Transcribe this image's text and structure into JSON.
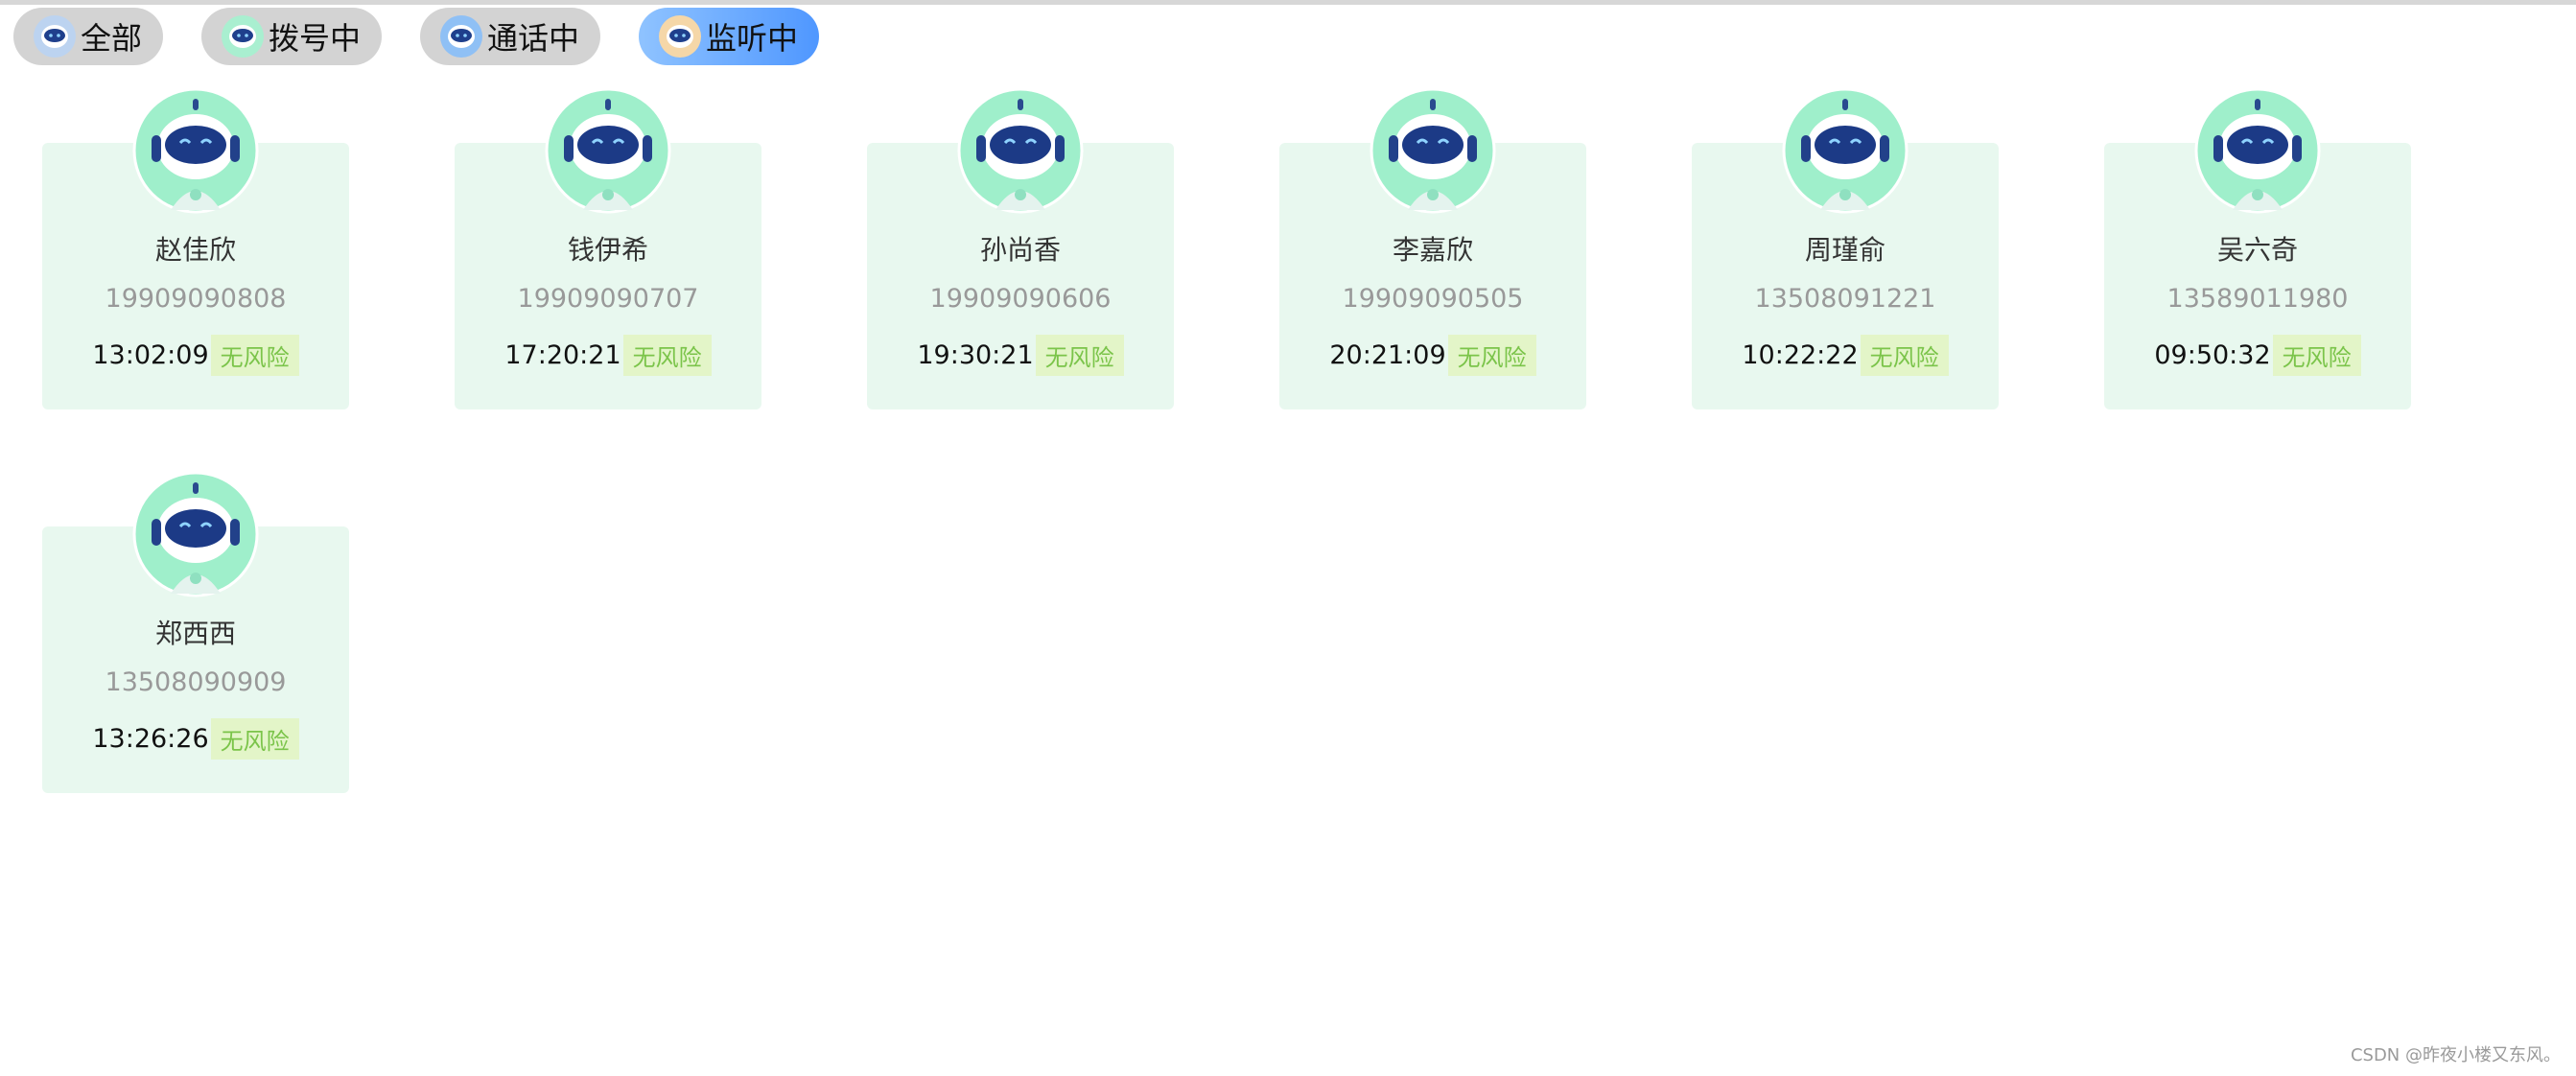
{
  "filters": [
    {
      "label": "全部",
      "active": false
    },
    {
      "label": "拨号中",
      "active": false
    },
    {
      "label": "通话中",
      "active": false
    },
    {
      "label": "监听中",
      "active": true
    }
  ],
  "agents": [
    {
      "name": "赵佳欣",
      "phone": "19909090808",
      "time": "13:02:09",
      "risk": "无风险"
    },
    {
      "name": "钱伊希",
      "phone": "19909090707",
      "time": "17:20:21",
      "risk": "无风险"
    },
    {
      "name": "孙尚香",
      "phone": "19909090606",
      "time": "19:30:21",
      "risk": "无风险"
    },
    {
      "name": "李嘉欣",
      "phone": "19909090505",
      "time": "20:21:09",
      "risk": "无风险"
    },
    {
      "name": "周瑾俞",
      "phone": "13508091221",
      "time": "10:22:22",
      "risk": "无风险"
    },
    {
      "name": "吴六奇",
      "phone": "13589011980",
      "time": "09:50:32",
      "risk": "无风险"
    },
    {
      "name": "郑西西",
      "phone": "13508090909",
      "time": "13:26:26",
      "risk": "无风险"
    }
  ],
  "watermark": "CSDN @昨夜小楼又东风。",
  "colors": {
    "card_bg": "#e8f8ef",
    "risk_text": "#7bc44a",
    "risk_bg": "#e3f5c8",
    "active_filter": "#4f97ff"
  }
}
